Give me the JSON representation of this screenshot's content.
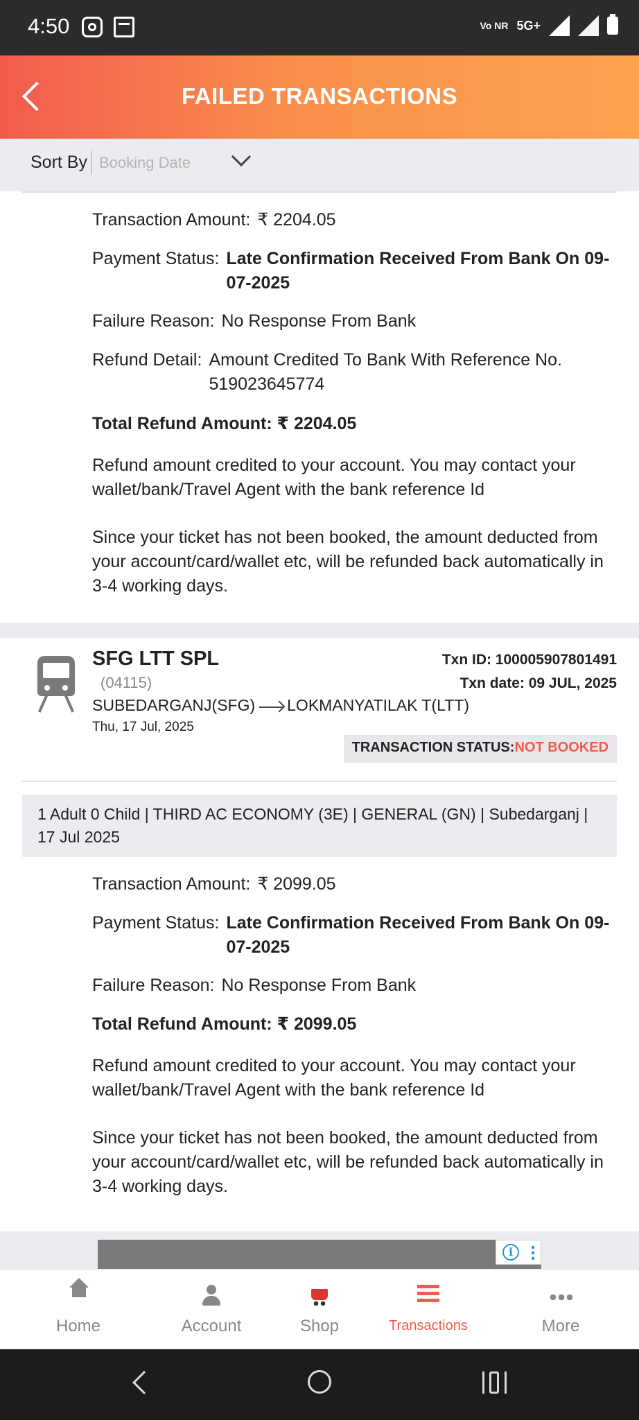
{
  "status_bar": {
    "time": "4:50",
    "network_volte": "Vo NR",
    "network_type": "5G+"
  },
  "header": {
    "title": "FAILED TRANSACTIONS"
  },
  "sort": {
    "label": "Sort By",
    "value": "Booking Date"
  },
  "transactions": [
    {
      "transaction_amount_label": "Transaction Amount:",
      "transaction_amount": "₹  2204.05",
      "payment_status_label": "Payment Status:",
      "payment_status": "Late Confirmation Received From Bank On 09-07-2025",
      "failure_reason_label": "Failure Reason:",
      "failure_reason": "No Response From Bank",
      "refund_detail_label": "Refund Detail:",
      "refund_detail": "Amount Credited To Bank With Reference No. 519023645774",
      "total_refund": "Total Refund Amount: ₹ 2204.05",
      "note1": "Refund amount credited to your account. You may contact your wallet/bank/Travel Agent with the bank reference Id",
      "note2": "Since your ticket has not been booked, the amount deducted from your account/card/wallet etc, will be refunded back automatically in 3-4 working days."
    },
    {
      "train_name": "SFG LTT  SPL",
      "train_number": "(04115)",
      "from_station": "SUBEDARGANJ(SFG)",
      "to_station": "LOKMANYATILAK T(LTT)",
      "journey_date": "Thu, 17 Jul, 2025",
      "txn_id": "Txn ID: 100005907801491",
      "txn_date": "Txn date: 09 JUL, 2025",
      "transaction_status_label": "TRANSACTION STATUS:",
      "transaction_status": "NOT BOOKED",
      "class_info": "1 Adult 0 Child  | THIRD AC ECONOMY (3E) | GENERAL (GN) | Subedarganj | 17 Jul 2025",
      "transaction_amount_label": "Transaction Amount:",
      "transaction_amount": "₹  2099.05",
      "payment_status_label": "Payment Status:",
      "payment_status": "Late Confirmation Received From Bank On 09-07-2025",
      "failure_reason_label": "Failure Reason:",
      "failure_reason": "No Response From Bank",
      "total_refund": "Total Refund Amount: ₹ 2099.05",
      "note1": "Refund amount credited to your account. You may contact your wallet/bank/Travel Agent with the bank reference Id",
      "note2": "Since your ticket has not been booked, the amount deducted from your account/card/wallet etc, will be refunded back automatically in 3-4 working days."
    }
  ],
  "ad": {
    "info_glyph": "i"
  },
  "bottom_nav": {
    "items": [
      {
        "label": "Home",
        "icon": "home-icon"
      },
      {
        "label": "Account",
        "icon": "account-icon"
      },
      {
        "label": "Shop",
        "icon": "shop-cart-icon"
      },
      {
        "label": "Transactions",
        "icon": "list-icon",
        "active": true
      },
      {
        "label": "More",
        "icon": "more-dots-icon"
      }
    ]
  },
  "colors": {
    "accent": "#f25b4d",
    "header_gradient_end": "#fda24d"
  }
}
